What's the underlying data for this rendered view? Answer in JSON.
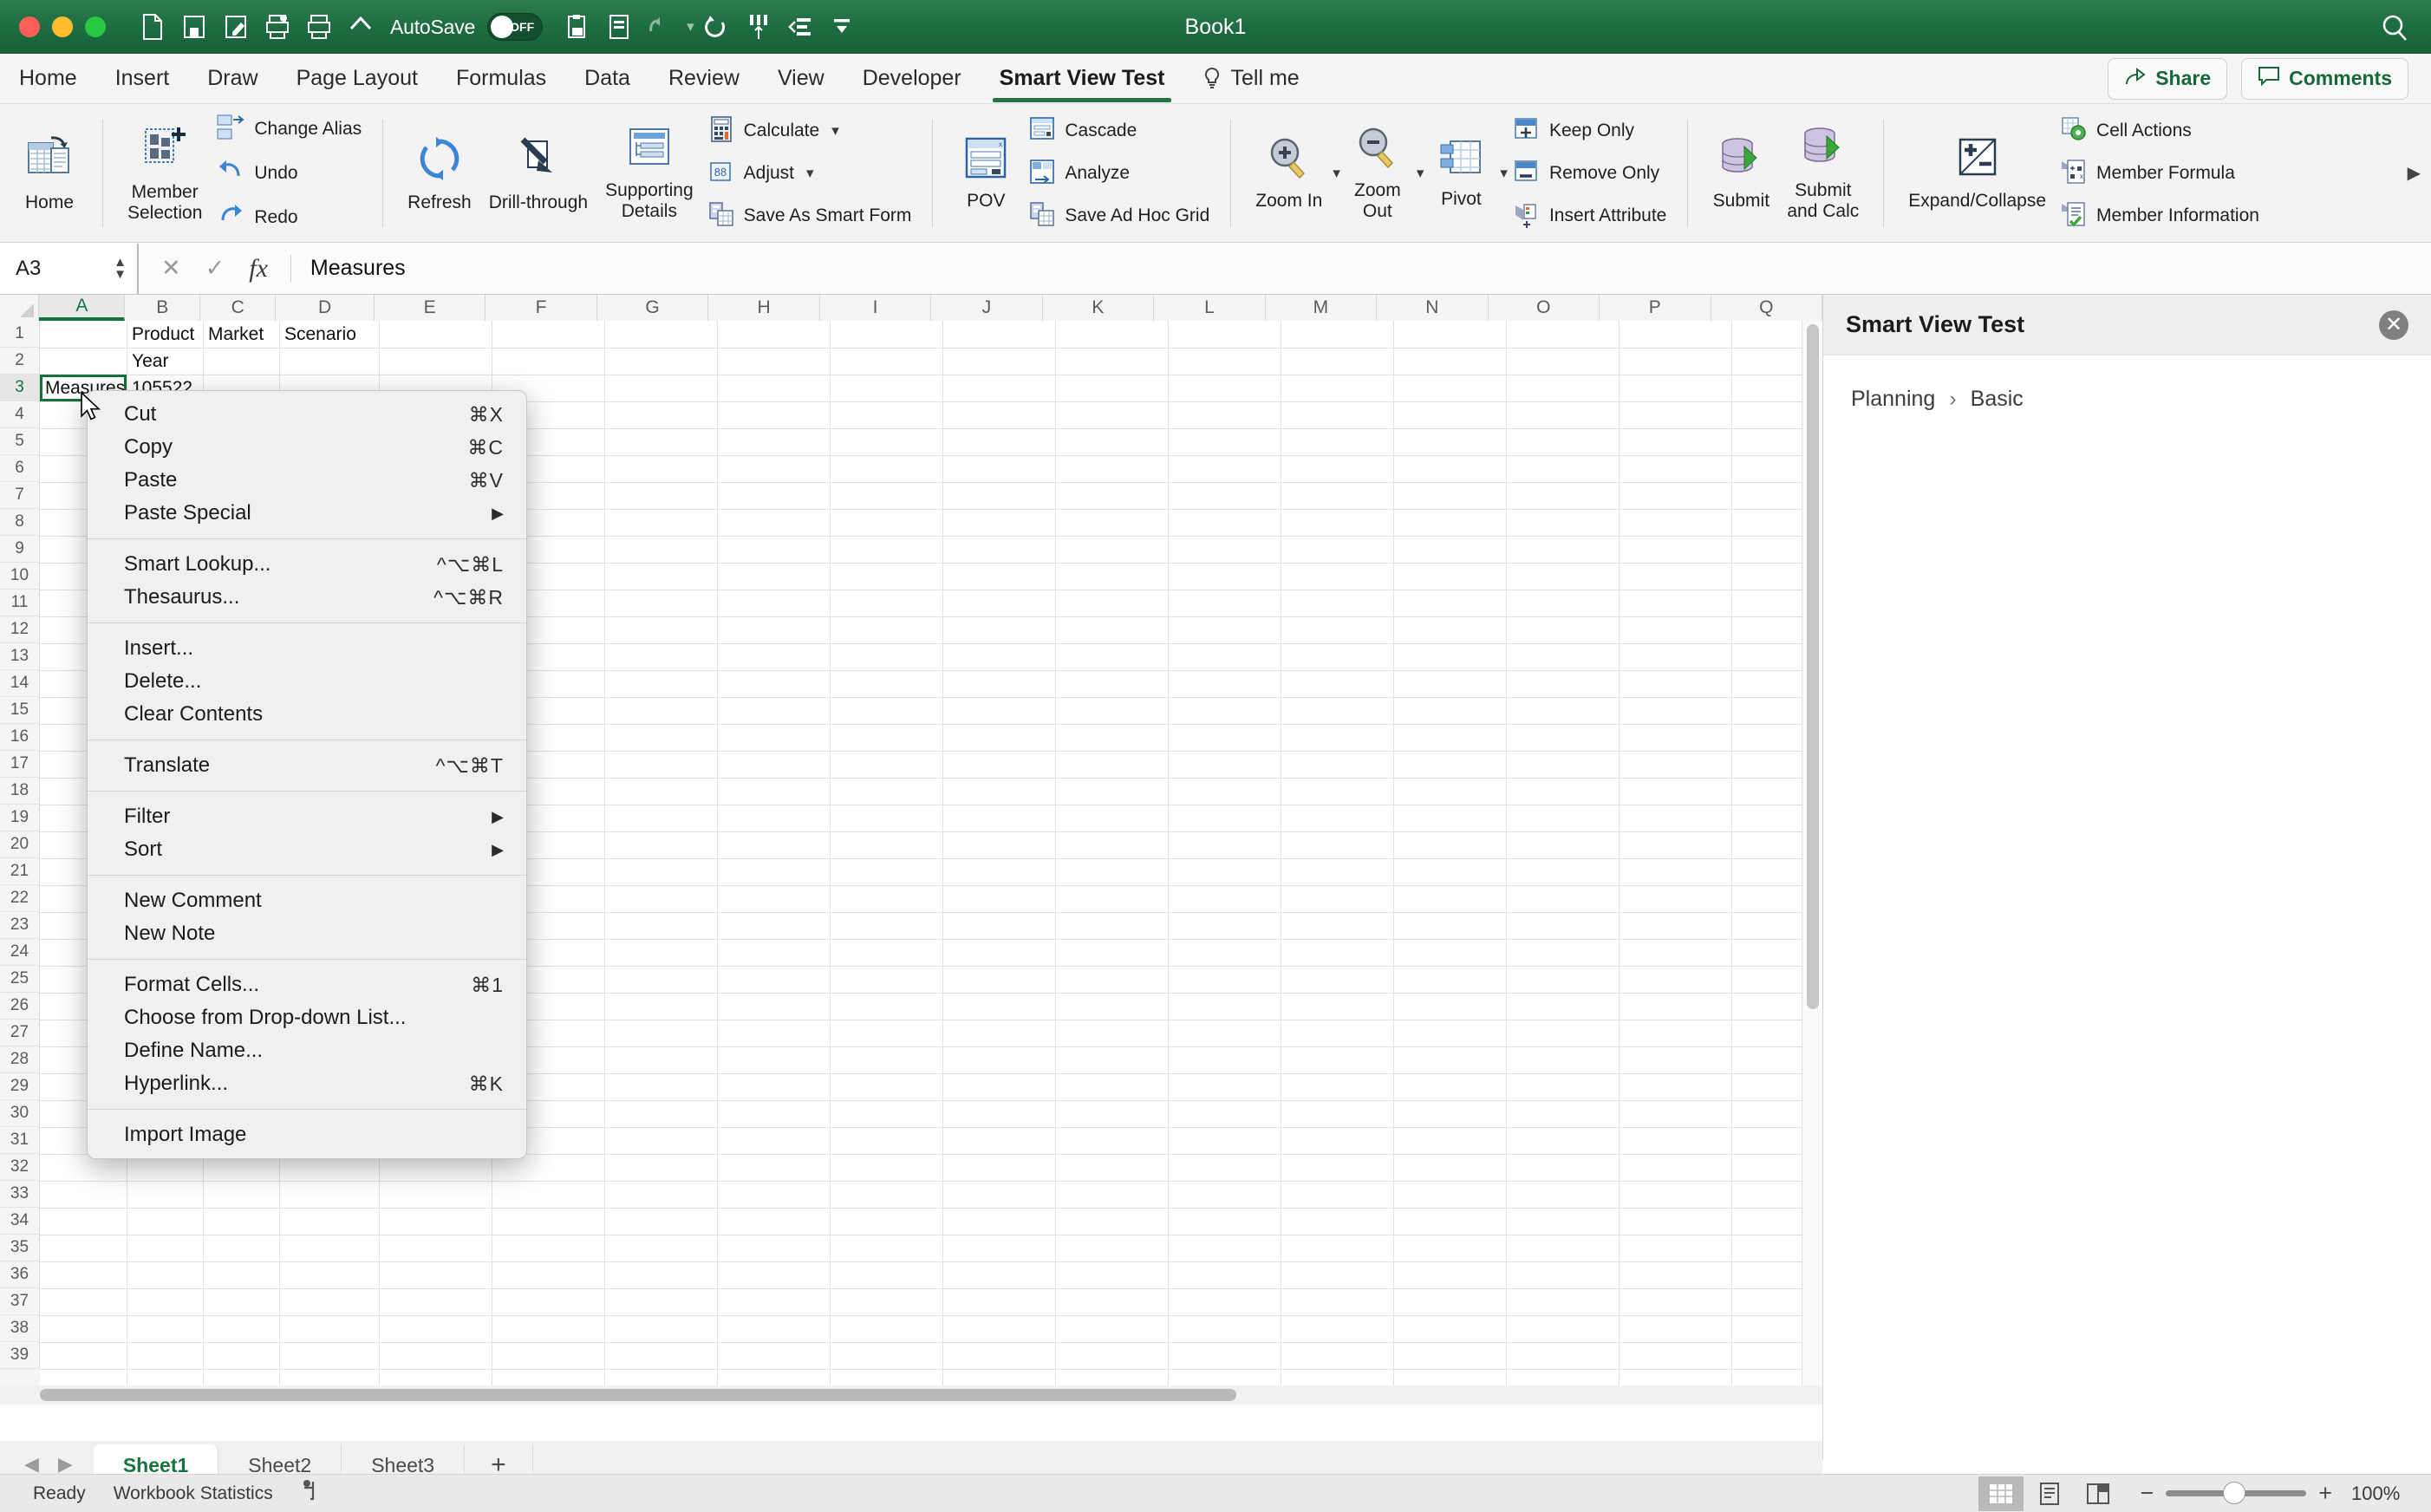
{
  "titlebar": {
    "document_title": "Book1",
    "autosave_label": "AutoSave",
    "autosave_state": "OFF",
    "quick_access": [
      {
        "name": "new-document-icon",
        "label": "New"
      },
      {
        "name": "save-icon",
        "label": "Save"
      },
      {
        "name": "save-as-icon",
        "label": "Save As"
      },
      {
        "name": "print-preview-icon",
        "label": "Print Preview"
      },
      {
        "name": "print-icon",
        "label": "Print"
      },
      {
        "name": "home-icon",
        "label": "Home"
      },
      {
        "name": "clipboard-picture-icon",
        "label": "Paste Picture"
      },
      {
        "name": "form-icon",
        "label": "Form"
      },
      {
        "name": "undo-icon",
        "label": "Undo"
      },
      {
        "name": "redo-icon",
        "label": "Redo"
      },
      {
        "name": "columns-icon",
        "label": "Columns"
      },
      {
        "name": "sort-filter-icon",
        "label": "Sort and Filter"
      },
      {
        "name": "customize-toolbar-icon",
        "label": "Customize"
      }
    ],
    "search_icon": "search-icon"
  },
  "tabs": {
    "items": [
      {
        "label": "Home",
        "active": false
      },
      {
        "label": "Insert",
        "active": false
      },
      {
        "label": "Draw",
        "active": false
      },
      {
        "label": "Page Layout",
        "active": false
      },
      {
        "label": "Formulas",
        "active": false
      },
      {
        "label": "Data",
        "active": false
      },
      {
        "label": "Review",
        "active": false
      },
      {
        "label": "View",
        "active": false
      },
      {
        "label": "Developer",
        "active": false
      },
      {
        "label": "Smart View Test",
        "active": true
      }
    ],
    "tell_me": "Tell me",
    "share": "Share",
    "comments": "Comments"
  },
  "ribbon": {
    "groups": [
      {
        "name": "home-group",
        "big": [
          {
            "label": "Home",
            "icon": "home-grid-icon"
          }
        ],
        "small": []
      },
      {
        "name": "member-group",
        "big": [
          {
            "label": "Member\nSelection",
            "icon": "member-selection-icon"
          }
        ],
        "small": [
          {
            "label": "Change Alias",
            "icon": "change-alias-icon"
          },
          {
            "label": "Undo",
            "icon": "undo-arrow-icon"
          },
          {
            "label": "Redo",
            "icon": "redo-arrow-icon"
          }
        ]
      },
      {
        "name": "data-group",
        "big": [
          {
            "label": "Refresh",
            "icon": "refresh-icon"
          },
          {
            "label": "Drill-through",
            "icon": "drill-through-icon"
          },
          {
            "label": "Supporting\nDetails",
            "icon": "supporting-details-icon"
          }
        ],
        "small": [
          {
            "label": "Calculate",
            "icon": "calculator-icon",
            "has_dropdown": true
          },
          {
            "label": "Adjust",
            "icon": "adjust-icon",
            "has_dropdown": true
          },
          {
            "label": "Save As Smart Form",
            "icon": "smart-form-icon"
          }
        ]
      },
      {
        "name": "pov-group",
        "big": [
          {
            "label": "POV",
            "icon": "pov-icon"
          }
        ],
        "small": [
          {
            "label": "Cascade",
            "icon": "cascade-icon"
          },
          {
            "label": "Analyze",
            "icon": "analyze-icon"
          },
          {
            "label": "Save Ad Hoc Grid",
            "icon": "save-adhoc-grid-icon"
          }
        ]
      },
      {
        "name": "zoom-group",
        "big": [
          {
            "label": "Zoom In",
            "icon": "zoom-in-icon",
            "has_dropdown": true
          },
          {
            "label": "Zoom\nOut",
            "icon": "zoom-out-icon",
            "has_dropdown": true
          },
          {
            "label": "Pivot",
            "icon": "pivot-icon",
            "has_dropdown": true
          }
        ],
        "small": [
          {
            "label": "Keep Only",
            "icon": "keep-only-icon"
          },
          {
            "label": "Remove Only",
            "icon": "remove-only-icon"
          },
          {
            "label": "Insert Attribute",
            "icon": "insert-attribute-icon"
          }
        ]
      },
      {
        "name": "submit-group",
        "big": [
          {
            "label": "Submit",
            "icon": "submit-icon"
          },
          {
            "label": "Submit\nand Calc",
            "icon": "submit-and-calc-icon"
          }
        ],
        "small": []
      },
      {
        "name": "expand-group",
        "big": [
          {
            "label": "Expand/Collapse",
            "icon": "expand-collapse-icon"
          }
        ],
        "small": [
          {
            "label": "Cell Actions",
            "icon": "cell-actions-icon"
          },
          {
            "label": "Member Formula",
            "icon": "member-formula-icon"
          },
          {
            "label": "Member Information",
            "icon": "member-information-icon"
          }
        ]
      }
    ],
    "overflow_arrow": "chevron-right-icon"
  },
  "formula_bar": {
    "name_box": "A3",
    "cancel_icon": "cancel-icon",
    "confirm_icon": "confirm-icon",
    "function_icon": "fx",
    "value": "Measures"
  },
  "grid": {
    "columns": [
      "A",
      "B",
      "C",
      "D",
      "E",
      "F",
      "G",
      "H",
      "I",
      "J",
      "K",
      "L",
      "M",
      "N",
      "O",
      "P",
      "Q"
    ],
    "selected_column": "A",
    "selected_row": 3,
    "row_count": 39,
    "cells": [
      {
        "ref": "B1",
        "col": 1,
        "row": 1,
        "value": "Product"
      },
      {
        "ref": "C1",
        "col": 2,
        "row": 1,
        "value": "Market"
      },
      {
        "ref": "D1",
        "col": 3,
        "row": 1,
        "value": "Scenario"
      },
      {
        "ref": "B2",
        "col": 1,
        "row": 2,
        "value": "Year"
      },
      {
        "ref": "A3",
        "col": 0,
        "row": 3,
        "value": "Measures"
      },
      {
        "ref": "B3",
        "col": 1,
        "row": 3,
        "value": "105522"
      }
    ]
  },
  "context_menu": {
    "sections": [
      [
        {
          "label": "Cut",
          "shortcut": "⌘X"
        },
        {
          "label": "Copy",
          "shortcut": "⌘C"
        },
        {
          "label": "Paste",
          "shortcut": "⌘V"
        },
        {
          "label": "Paste Special",
          "submenu": true
        }
      ],
      [
        {
          "label": "Smart Lookup...",
          "shortcut": "^⌥⌘L"
        },
        {
          "label": "Thesaurus...",
          "shortcut": "^⌥⌘R"
        }
      ],
      [
        {
          "label": "Insert..."
        },
        {
          "label": "Delete..."
        },
        {
          "label": "Clear Contents"
        }
      ],
      [
        {
          "label": "Translate",
          "shortcut": "^⌥⌘T"
        }
      ],
      [
        {
          "label": "Filter",
          "submenu": true
        },
        {
          "label": "Sort",
          "submenu": true
        }
      ],
      [
        {
          "label": "New Comment"
        },
        {
          "label": "New Note"
        }
      ],
      [
        {
          "label": "Format Cells...",
          "shortcut": "⌘1"
        },
        {
          "label": "Choose from Drop-down List..."
        },
        {
          "label": "Define Name..."
        },
        {
          "label": "Hyperlink...",
          "shortcut": "⌘K"
        }
      ],
      [
        {
          "label": "Import Image"
        }
      ]
    ]
  },
  "task_pane": {
    "title": "Smart View Test",
    "close_icon": "close-icon",
    "breadcrumb": [
      "Planning",
      "Basic"
    ],
    "breadcrumb_separator": "›"
  },
  "sheet_tabs": {
    "prev_icon": "prev-sheet-icon",
    "next_icon": "next-sheet-icon",
    "items": [
      {
        "label": "Sheet1",
        "active": true
      },
      {
        "label": "Sheet2",
        "active": false
      },
      {
        "label": "Sheet3",
        "active": false
      }
    ],
    "add_label": "+"
  },
  "status_bar": {
    "status": "Ready",
    "workbook_statistics": "Workbook Statistics",
    "accessibility_icon": "accessibility-icon",
    "views": [
      {
        "name": "normal-view-icon",
        "active": true
      },
      {
        "name": "page-layout-view-icon",
        "active": false
      },
      {
        "name": "page-break-view-icon",
        "active": false
      }
    ],
    "zoom_out_label": "−",
    "zoom_in_label": "+",
    "zoom_level": "100%"
  },
  "colors": {
    "brand_green": "#217346",
    "title_green": "#1e6b41",
    "selection_green": "#15713d"
  }
}
